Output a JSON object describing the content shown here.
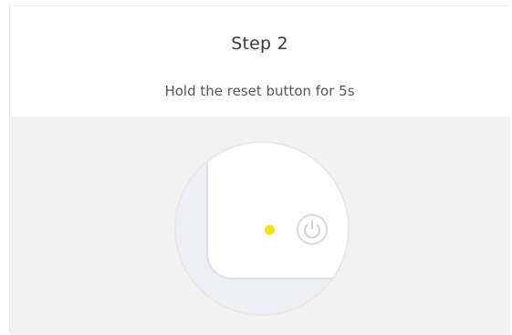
{
  "step": {
    "title": "Step 2",
    "instruction": "Hold the reset button for 5s"
  },
  "illustration": {
    "led_color": "#f4e11f",
    "background_color": "#f2f2f2",
    "icons": [
      "power-icon"
    ]
  }
}
